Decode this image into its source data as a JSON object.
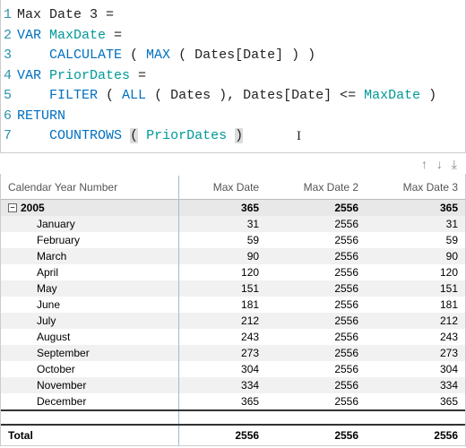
{
  "code": {
    "lines": [
      {
        "n": "1",
        "pre": "",
        "segs": [
          {
            "t": "Max Date 3 ="
          }
        ]
      },
      {
        "n": "2",
        "pre": "",
        "segs": [
          {
            "t": "VAR ",
            "cls": "kw-var"
          },
          {
            "t": "MaxDate",
            "cls": "ident-teal"
          },
          {
            "t": " ="
          }
        ]
      },
      {
        "n": "3",
        "pre": "    ",
        "segs": [
          {
            "t": "CALCULATE",
            "cls": "fn"
          },
          {
            "t": " ( "
          },
          {
            "t": "MAX",
            "cls": "fn"
          },
          {
            "t": " ( Dates[Date] ) )"
          }
        ]
      },
      {
        "n": "4",
        "pre": "",
        "segs": [
          {
            "t": "VAR ",
            "cls": "kw-var"
          },
          {
            "t": "PriorDates",
            "cls": "ident-teal"
          },
          {
            "t": " ="
          }
        ]
      },
      {
        "n": "5",
        "pre": "    ",
        "segs": [
          {
            "t": "FILTER",
            "cls": "fn"
          },
          {
            "t": " ( "
          },
          {
            "t": "ALL",
            "cls": "fn"
          },
          {
            "t": " ( Dates ), Dates[Date] <= "
          },
          {
            "t": "MaxDate",
            "cls": "ident-teal"
          },
          {
            "t": " )"
          }
        ]
      },
      {
        "n": "6",
        "pre": "",
        "segs": [
          {
            "t": "RETURN",
            "cls": "kw-ret"
          }
        ]
      },
      {
        "n": "7",
        "pre": "    ",
        "segs": [
          {
            "t": "COUNTROWS",
            "cls": "fn"
          },
          {
            "t": " "
          },
          {
            "t": "(",
            "cls": "hl"
          },
          {
            "t": " "
          },
          {
            "t": "PriorDates",
            "cls": "ident-teal"
          },
          {
            "t": " "
          },
          {
            "t": ")",
            "cls": "hl"
          }
        ]
      }
    ]
  },
  "nav": {
    "up": "↑",
    "down": "↓",
    "last": "⤓"
  },
  "table": {
    "headers": [
      "Calendar Year Number",
      "Max Date",
      "Max Date 2",
      "Max Date 3"
    ],
    "year": {
      "label": "2005",
      "maxdate": "365",
      "maxdate2": "2556",
      "maxdate3": "365"
    },
    "rows": [
      {
        "label": "January",
        "v1": "31",
        "v2": "2556",
        "v3": "31"
      },
      {
        "label": "February",
        "v1": "59",
        "v2": "2556",
        "v3": "59"
      },
      {
        "label": "March",
        "v1": "90",
        "v2": "2556",
        "v3": "90"
      },
      {
        "label": "April",
        "v1": "120",
        "v2": "2556",
        "v3": "120"
      },
      {
        "label": "May",
        "v1": "151",
        "v2": "2556",
        "v3": "151"
      },
      {
        "label": "June",
        "v1": "181",
        "v2": "2556",
        "v3": "181"
      },
      {
        "label": "July",
        "v1": "212",
        "v2": "2556",
        "v3": "212"
      },
      {
        "label": "August",
        "v1": "243",
        "v2": "2556",
        "v3": "243"
      },
      {
        "label": "September",
        "v1": "273",
        "v2": "2556",
        "v3": "273"
      },
      {
        "label": "October",
        "v1": "304",
        "v2": "2556",
        "v3": "304"
      },
      {
        "label": "November",
        "v1": "334",
        "v2": "2556",
        "v3": "334"
      },
      {
        "label": "December",
        "v1": "365",
        "v2": "2556",
        "v3": "365"
      }
    ],
    "total": {
      "label": "Total",
      "v1": "2556",
      "v2": "2556",
      "v3": "2556"
    }
  }
}
